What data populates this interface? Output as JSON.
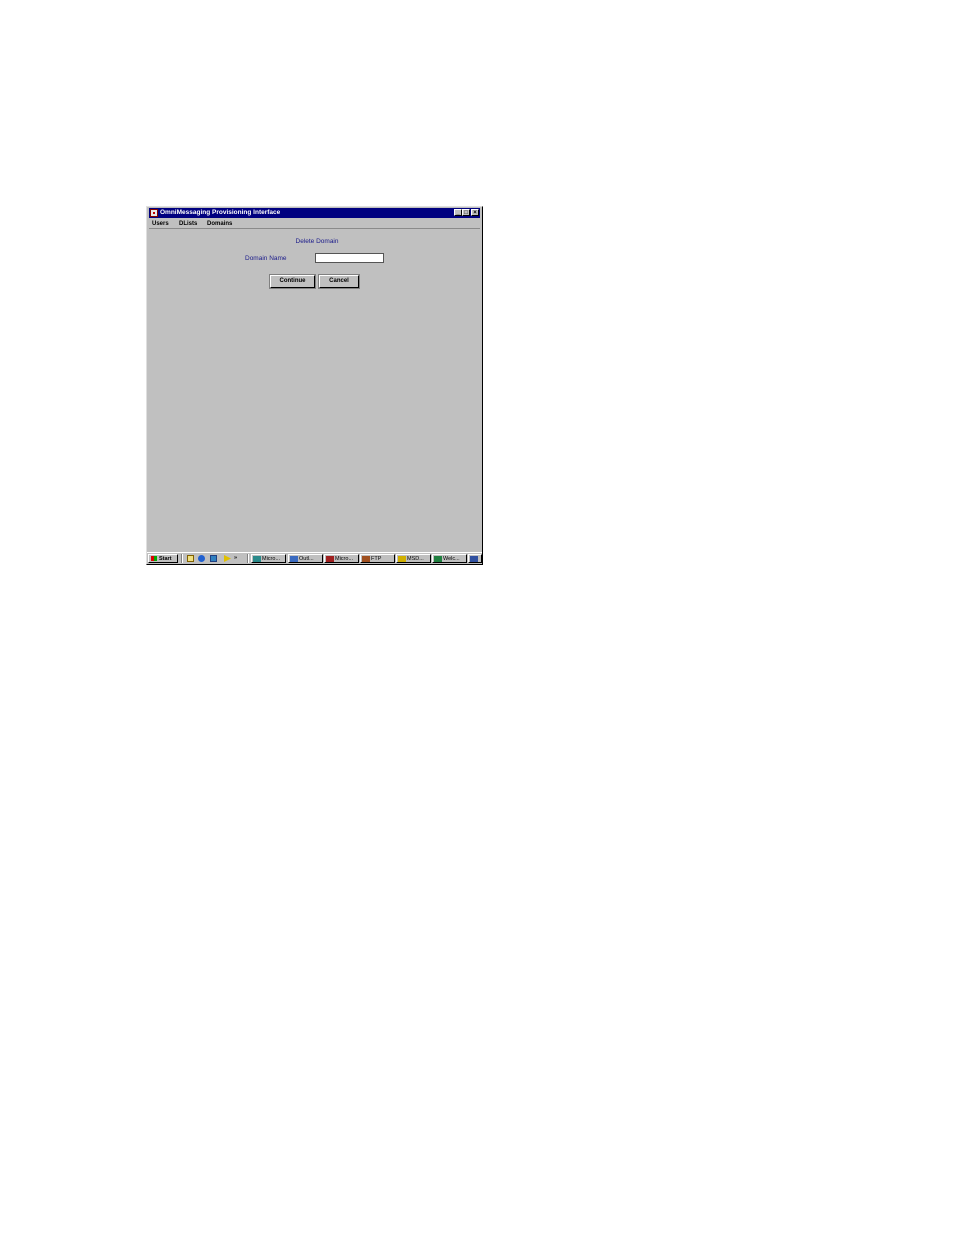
{
  "window": {
    "title": "OmniMessaging Provisioning Interface",
    "controls": [
      "_",
      "□",
      "×"
    ]
  },
  "menu": {
    "users": "Users",
    "dlists": "DLists",
    "domains": "Domains"
  },
  "form": {
    "heading": "Delete Domain",
    "domain_label": "Domain Name",
    "domain_value": "",
    "continue_label": "Continue",
    "cancel_label": "Cancel"
  },
  "taskbar": {
    "start_label": "Start",
    "more_label": "»",
    "quicklaunch_icons": [
      "show-desktop-icon",
      "internet-explorer-icon",
      "outlook-icon",
      "media-player-icon"
    ],
    "tasks": [
      {
        "label": "Micro...",
        "icon": "word-icon",
        "color": "#2a8a8a"
      },
      {
        "label": "Outl...",
        "icon": "outlook-icon",
        "color": "#3a6ac0"
      },
      {
        "label": "Micro...",
        "icon": "app-icon",
        "color": "#a02020"
      },
      {
        "label": "FTP",
        "icon": "ftp-icon",
        "color": "#a05020"
      },
      {
        "label": "MSD...",
        "icon": "msdos-icon",
        "color": "#d0b000"
      },
      {
        "label": "Welc...",
        "icon": "globe-icon",
        "color": "#208040"
      },
      {
        "label": "",
        "icon": "app-icon",
        "color": "#3050a0"
      }
    ]
  },
  "colors": {
    "titlebar": "#000080",
    "window_bg": "#c0c0c0",
    "label_text": "#1a1a8a"
  }
}
